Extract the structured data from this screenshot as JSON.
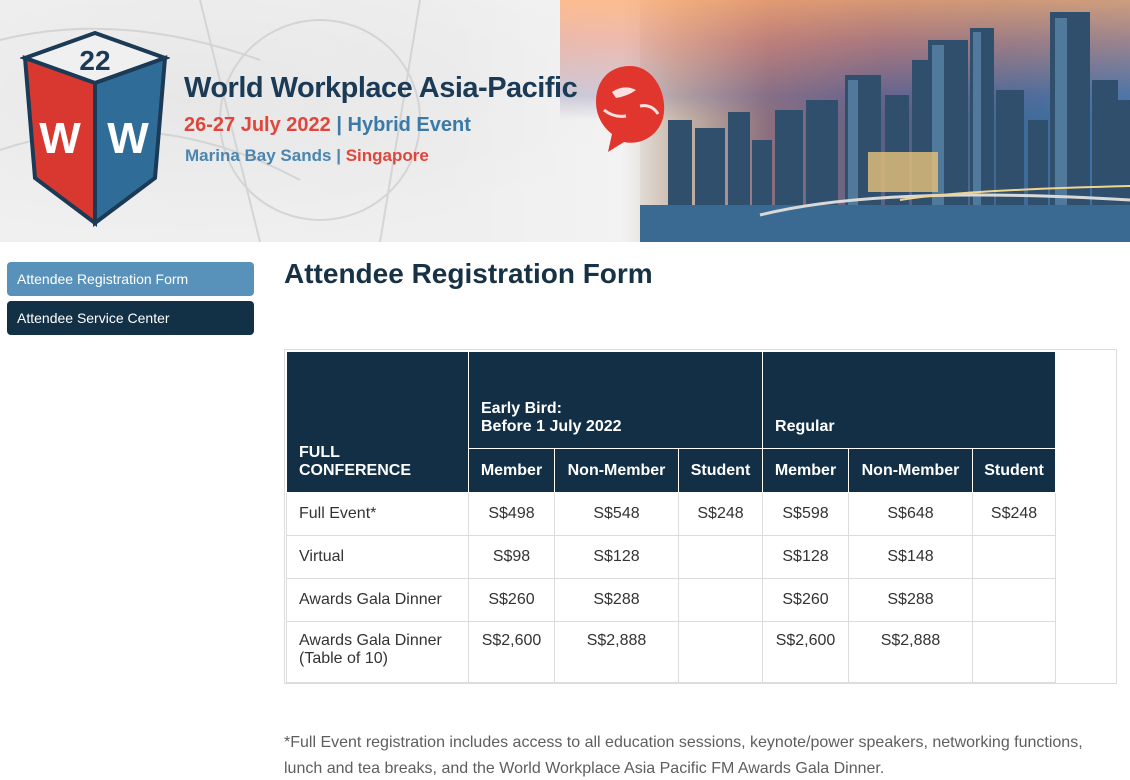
{
  "banner": {
    "title": "World Workplace Asia-Pacific",
    "dates": "26-27 July 2022",
    "separator": "|",
    "event_type": "Hybrid Event",
    "venue": "Marina Bay Sands",
    "venue_separator": "|",
    "city": "Singapore",
    "logo_text": "22 WW",
    "colors": {
      "navy": "#1b3a56",
      "red": "#e0463c",
      "blue": "#3a7aa6"
    }
  },
  "sidebar": {
    "items": [
      {
        "label": "Attendee Registration Form",
        "active": true
      },
      {
        "label": "Attendee Service Center",
        "active": false
      }
    ]
  },
  "main": {
    "title": "Attendee Registration Form",
    "table": {
      "corner_header": "FULL CONFERENCE",
      "groups": [
        {
          "line1": "Early Bird:",
          "line2": "Before 1 July 2022"
        },
        {
          "line1": "Regular",
          "line2": ""
        }
      ],
      "sub_headers": [
        "Member",
        "Non-Member",
        "Student",
        "Member",
        "Non-Member",
        "Student"
      ],
      "rows": [
        {
          "label": "Full Event*",
          "label2": "",
          "values": [
            "S$498",
            "S$548",
            "S$248",
            "S$598",
            "S$648",
            "S$248"
          ]
        },
        {
          "label": "Virtual",
          "label2": "",
          "values": [
            "S$98",
            "S$128",
            "",
            "S$128",
            "S$148",
            ""
          ]
        },
        {
          "label": "Awards Gala Dinner",
          "label2": "",
          "values": [
            "S$260",
            "S$288",
            "",
            "S$260",
            "S$288",
            ""
          ]
        },
        {
          "label": "Awards Gala Dinner",
          "label2": "(Table of 10)",
          "values": [
            "S$2,600",
            "S$2,888",
            "",
            "S$2,600",
            "S$2,888",
            ""
          ]
        }
      ]
    },
    "footnote": "*Full Event registration includes access to all education sessions, keynote/power speakers, networking functions, lunch and tea breaks, and the World Workplace Asia Pacific FM Awards Gala Dinner."
  }
}
